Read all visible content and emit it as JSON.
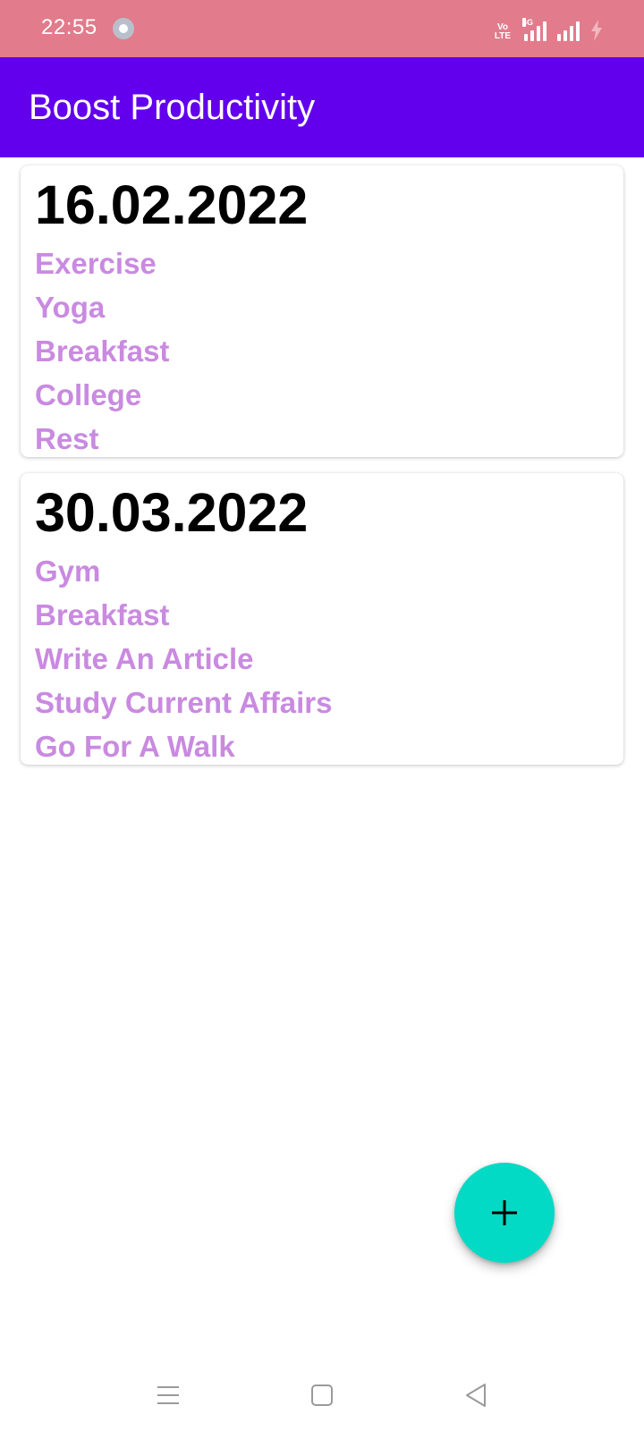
{
  "status_bar": {
    "time": "22:55",
    "volte_line1": "Vo",
    "volte_line2": "LTE",
    "network": "4G",
    "background": "#e27b8b"
  },
  "app_bar": {
    "title": "Boost Productivity",
    "background": "#6200ee"
  },
  "cards": [
    {
      "date": "16.02.2022",
      "tasks": [
        "Exercise",
        "Yoga",
        "Breakfast",
        "College",
        "Rest"
      ]
    },
    {
      "date": "30.03.2022",
      "tasks": [
        "Gym",
        "Breakfast",
        "Write An Article",
        "Study Current Affairs",
        "Go For A Walk"
      ]
    }
  ],
  "colors": {
    "task_text": "#c98ae0",
    "fab": "#03dac5"
  },
  "fab": {
    "icon": "plus-icon"
  },
  "nav_bar": {
    "icons": [
      "menu-icon",
      "home-icon",
      "back-icon"
    ]
  }
}
